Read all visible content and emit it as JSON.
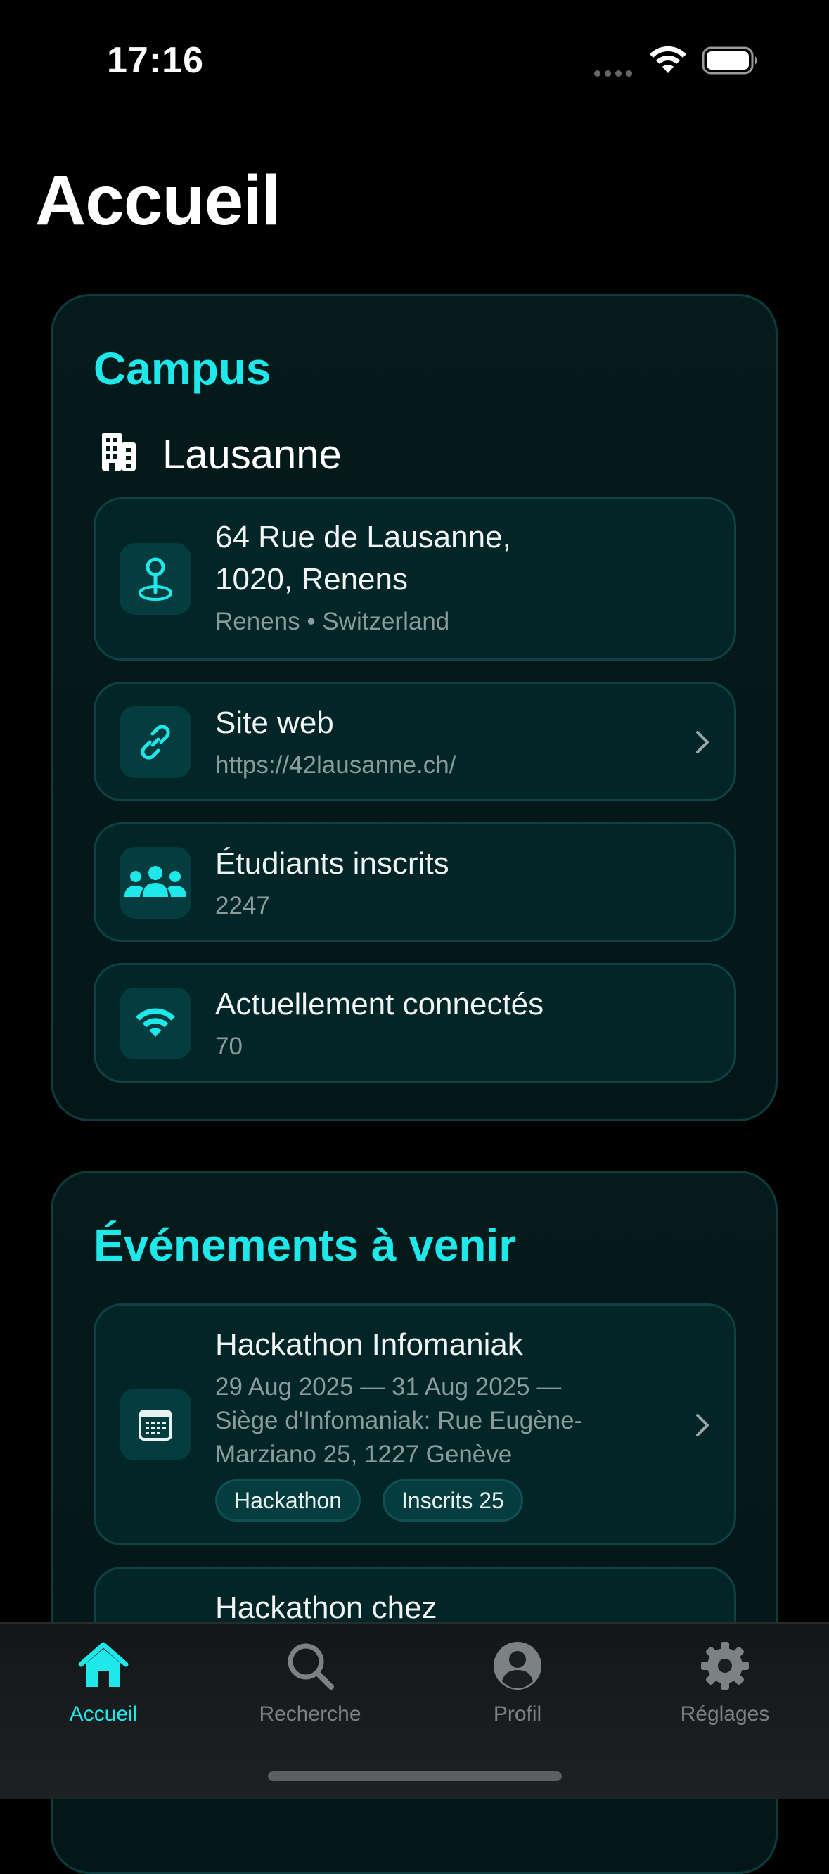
{
  "status_bar": {
    "time": "17:16"
  },
  "page": {
    "title": "Accueil"
  },
  "campus": {
    "section_title": "Campus",
    "name": "Lausanne",
    "address": {
      "line1": "64 Rue de Lausanne,",
      "line2": "1020, Renens",
      "city_country": "Renens • Switzerland",
      "icon": "map-pin-icon"
    },
    "website": {
      "title": "Site web",
      "url": "https://42lausanne.ch/",
      "icon": "link-icon"
    },
    "students": {
      "title": "Étudiants inscrits",
      "value": "2247",
      "icon": "people-icon"
    },
    "connected": {
      "title": "Actuellement connectés",
      "value": "70",
      "icon": "wifi-icon"
    }
  },
  "events": {
    "section_title": "Événements à venir",
    "items": [
      {
        "title": "Hackathon Infomaniak",
        "detail_line1": "29 Aug 2025 — 31 Aug 2025 —",
        "detail_line2": "Siège d'Infomaniak: Rue Eugène-",
        "detail_line3": "Marziano 25, 1227 Genève",
        "tags": [
          "Hackathon",
          "Inscrits 25"
        ],
        "icon": "calendar-icon"
      },
      {
        "title": "Hackathon chez"
      }
    ]
  },
  "tab_bar": {
    "tabs": [
      {
        "label": "Accueil",
        "icon": "house-icon",
        "active": true
      },
      {
        "label": "Recherche",
        "icon": "search-icon",
        "active": false
      },
      {
        "label": "Profil",
        "icon": "profile-icon",
        "active": false
      },
      {
        "label": "Réglages",
        "icon": "gear-icon",
        "active": false
      }
    ]
  },
  "colors": {
    "accent": "#1ee8ea",
    "background": "#000000",
    "card": "#041a1b",
    "row": "#022628"
  }
}
